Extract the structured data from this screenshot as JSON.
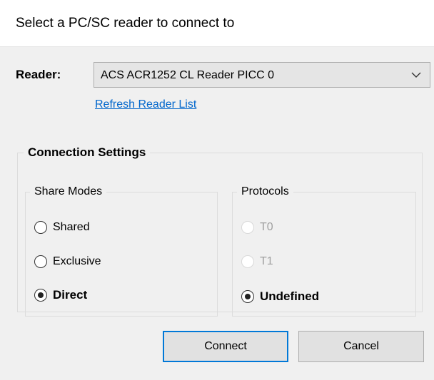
{
  "dialog": {
    "title": "Select a PC/SC reader to connect to"
  },
  "reader": {
    "label": "Reader:",
    "selected": "ACS ACR1252 CL Reader PICC 0",
    "refresh_link": "Refresh Reader List"
  },
  "connection_settings": {
    "legend": "Connection Settings",
    "share_modes": {
      "legend": "Share Modes",
      "options": [
        "Shared",
        "Exclusive",
        "Direct"
      ],
      "selected": "Direct"
    },
    "protocols": {
      "legend": "Protocols",
      "options": [
        "T0",
        "T1",
        "Undefined"
      ],
      "selected": "Undefined",
      "disabled": [
        "T0",
        "T1"
      ]
    }
  },
  "buttons": {
    "connect": "Connect",
    "cancel": "Cancel"
  },
  "colors": {
    "link": "#0066cc",
    "default_button_border": "#0078d7",
    "background": "#f0f0f0"
  }
}
